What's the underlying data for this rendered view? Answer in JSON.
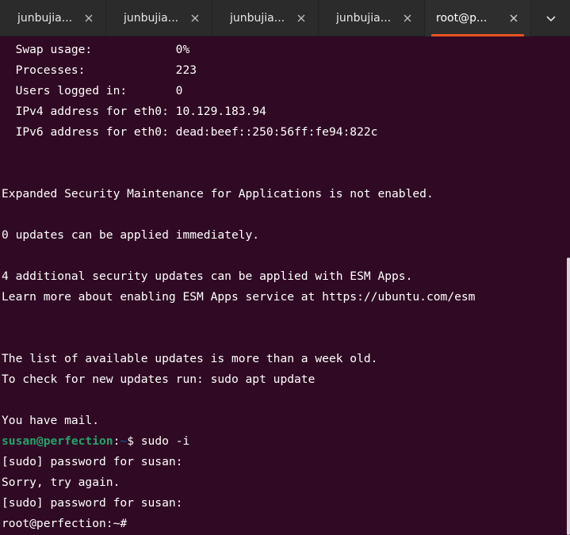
{
  "tabs": [
    {
      "label": "junbujia...",
      "active": false
    },
    {
      "label": "junbujia...",
      "active": false
    },
    {
      "label": "junbujia...",
      "active": false
    },
    {
      "label": "junbujia...",
      "active": false
    },
    {
      "label": "root@p...",
      "active": true
    }
  ],
  "colors": {
    "terminal_bg": "#300a24",
    "text": "#ffffff",
    "prompt_user": "#26a269",
    "prompt_path": "#12488b",
    "accent": "#e95420"
  },
  "terminal": {
    "lines": [
      "  Swap usage:            0%",
      "  Processes:             223",
      "  Users logged in:       0",
      "  IPv4 address for eth0: 10.129.183.94",
      "  IPv6 address for eth0: dead:beef::250:56ff:fe94:822c",
      "",
      "",
      "Expanded Security Maintenance for Applications is not enabled.",
      "",
      "0 updates can be applied immediately.",
      "",
      "4 additional security updates can be applied with ESM Apps.",
      "Learn more about enabling ESM Apps service at https://ubuntu.com/esm",
      "",
      "",
      "The list of available updates is more than a week old.",
      "To check for new updates run: sudo apt update",
      "",
      "You have mail."
    ],
    "prompt1": {
      "user_host": "susan@perfection",
      "colon": ":",
      "path": "~",
      "symbol": "$ ",
      "command": "sudo -i"
    },
    "after_prompt": [
      "[sudo] password for susan:",
      "Sorry, try again.",
      "[sudo] password for susan:"
    ],
    "final_prompt": "root@perfection:~#"
  }
}
